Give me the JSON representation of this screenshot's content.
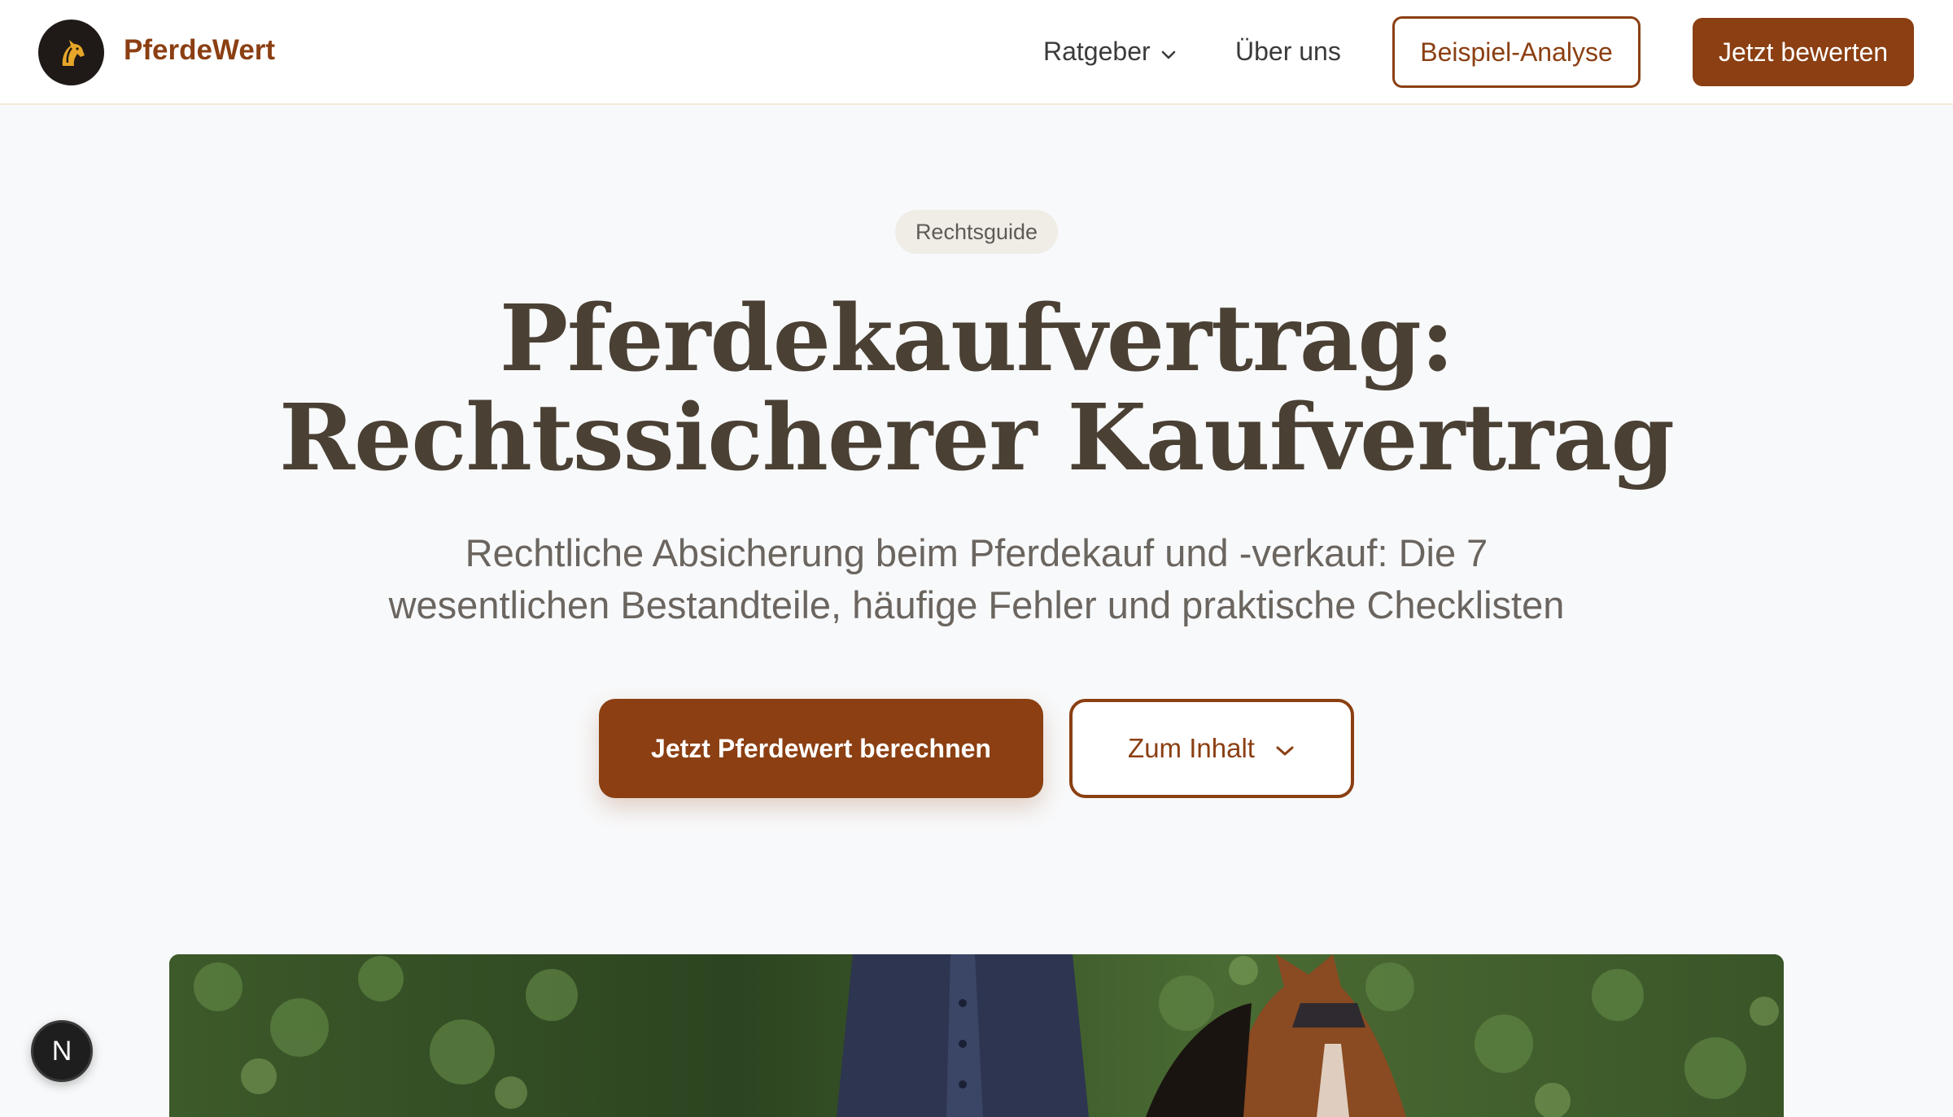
{
  "header": {
    "brand": "PferdeWert",
    "nav": {
      "ratgeber": "Ratgeber",
      "ueber_uns": "Über uns"
    },
    "beispiel_label": "Beispiel-Analyse",
    "bewerten_label": "Jetzt bewerten"
  },
  "hero": {
    "badge": "Rechtsguide",
    "title_line1": "Pferdekaufvertrag:",
    "title_line2": "Rechtssicherer Kaufvertrag",
    "subtitle_line1": "Rechtliche Absicherung beim Pferdekauf und -verkauf: Die 7",
    "subtitle_line2": "wesentlichen Bestandteile, häufige Fehler und praktische Checklisten",
    "primary_cta": "Jetzt Pferdewert berechnen",
    "secondary_cta": "Zum Inhalt"
  },
  "dev_badge": "N",
  "colors": {
    "brand": "#8b3f12",
    "title": "#4a4034",
    "background": "#f8f9fa"
  },
  "icons": [
    "horse-logo-icon",
    "chevron-down-icon",
    "nextjs-icon"
  ]
}
